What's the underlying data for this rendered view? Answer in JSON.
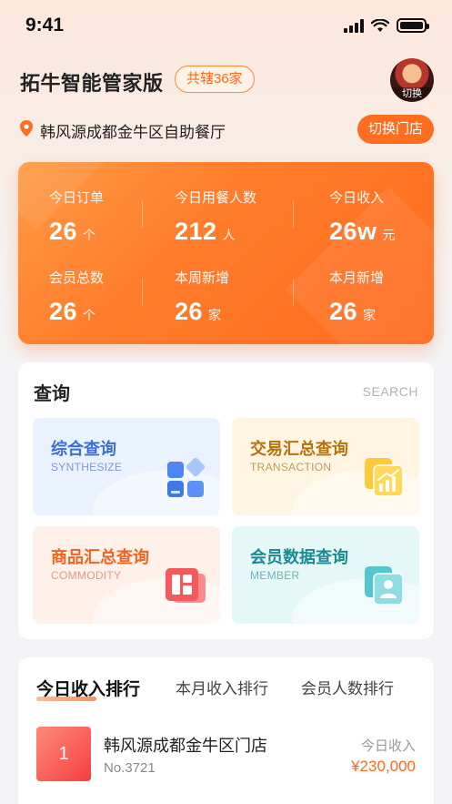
{
  "status_bar": {
    "time": "9:41"
  },
  "header": {
    "app_title": "拓牛智能管家版",
    "store_count_badge": "共辖36家",
    "avatar_label": "切换"
  },
  "location": {
    "store_name": "韩风源成都金牛区自助餐厅",
    "switch_button": "切换门店"
  },
  "stats": [
    {
      "label": "今日订单",
      "value": "26",
      "unit": "个"
    },
    {
      "label": "今日用餐人数",
      "value": "212",
      "unit": "人"
    },
    {
      "label": "今日收入",
      "value": "26w",
      "unit": "元"
    },
    {
      "label": "会员总数",
      "value": "26",
      "unit": "个"
    },
    {
      "label": "本周新增",
      "value": "26",
      "unit": "家"
    },
    {
      "label": "本月新增",
      "value": "26",
      "unit": "家"
    }
  ],
  "query": {
    "title": "查询",
    "subtitle": "SEARCH",
    "tiles": [
      {
        "title": "综合查询",
        "subtitle": "SYNTHESIZE",
        "title_color": "#3a6fd8",
        "sub_color": "#7f9ad4",
        "bg": "#eaf1ff",
        "icon": "grid-blocks-icon"
      },
      {
        "title": "交易汇总查询",
        "subtitle": "TRANSACTION",
        "title_color": "#b8720a",
        "sub_color": "#c09a5a",
        "bg": "#fff5e2",
        "icon": "bar-chart-icon"
      },
      {
        "title": "商品汇总查询",
        "subtitle": "COMMODITY",
        "title_color": "#f0641e",
        "sub_color": "#e79a7a",
        "bg": "#fff0ea",
        "icon": "layout-icon"
      },
      {
        "title": "会员数据查询",
        "subtitle": "MEMBER",
        "title_color": "#1a8a95",
        "sub_color": "#6fb4ba",
        "bg": "#e6f7f7",
        "icon": "member-card-icon"
      }
    ]
  },
  "ranking": {
    "tabs": [
      "今日收入排行",
      "本月收入排行",
      "会员人数排行"
    ],
    "items": [
      {
        "rank": "1",
        "store_name": "韩风源成都金牛区门店",
        "store_no": "No.3721",
        "metric_label": "今日收入",
        "metric_value": "¥230,000"
      }
    ]
  },
  "colors": {
    "accent": "#ff6d1f",
    "rank_badge": "#f45a4a"
  }
}
